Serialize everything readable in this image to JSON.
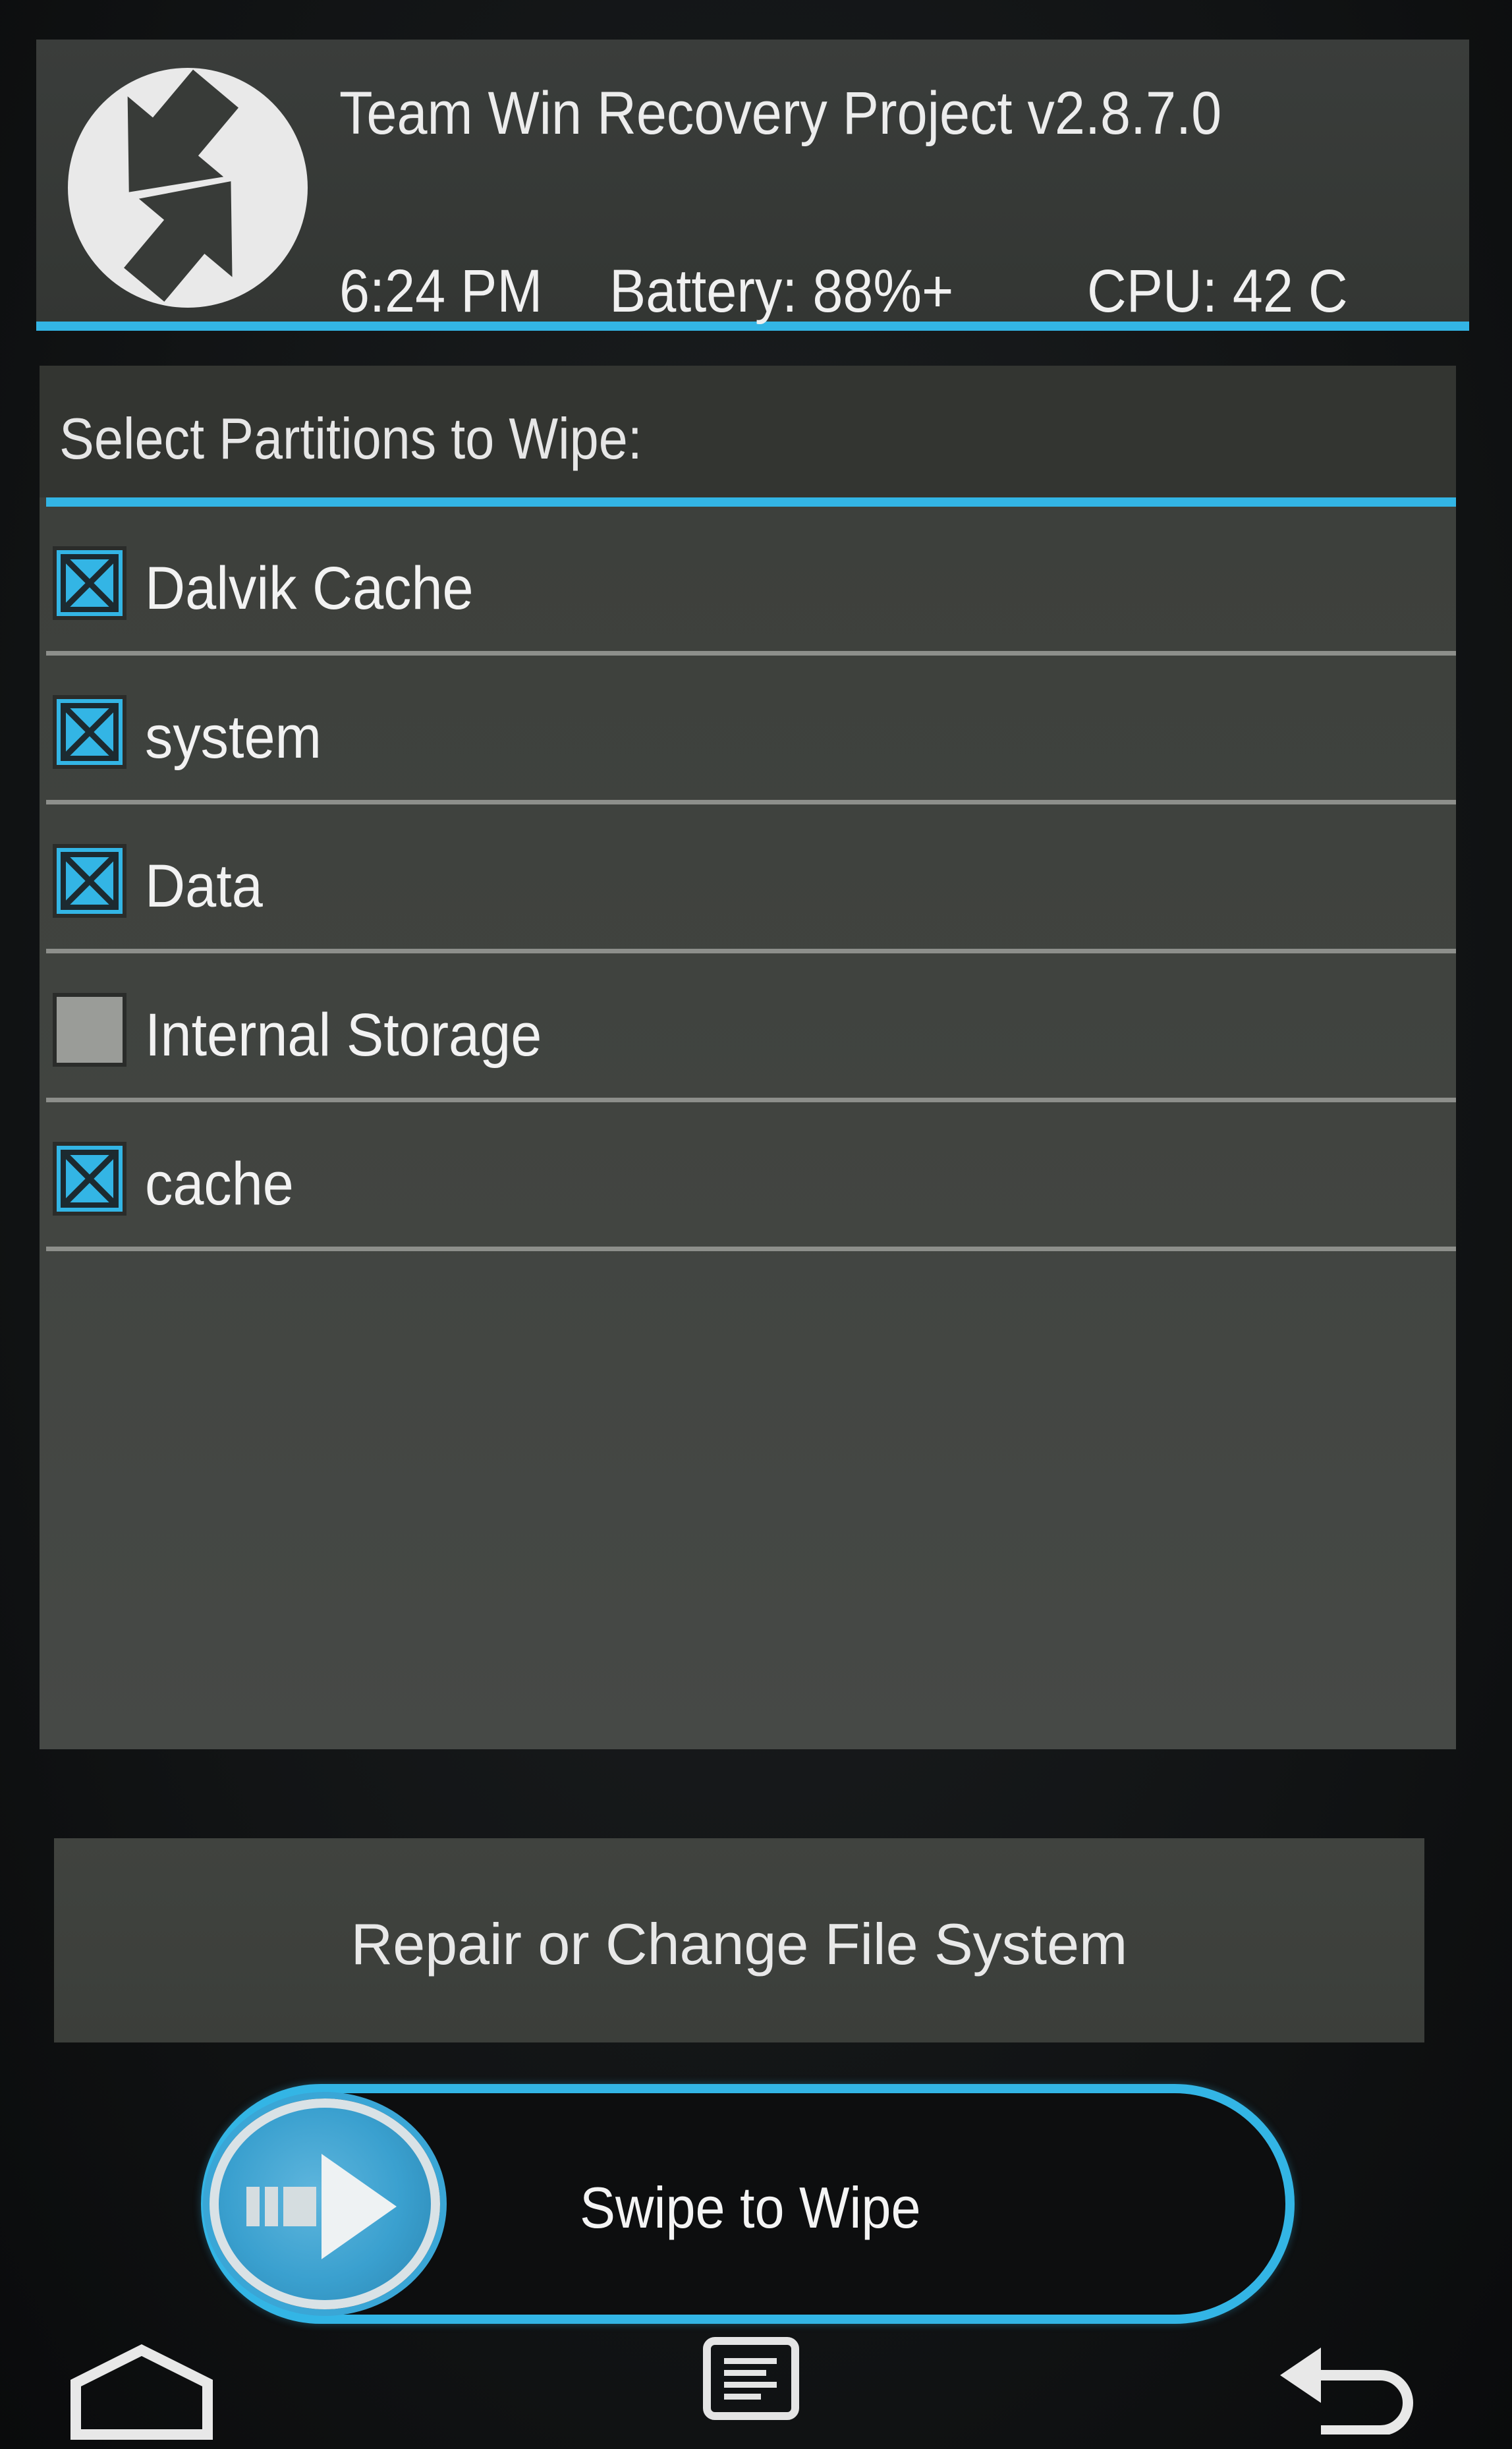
{
  "header": {
    "title": "Team Win Recovery Project  v2.8.7.0",
    "time": "6:24 PM",
    "battery": "Battery: 88%+",
    "cpu": "CPU: 42 C",
    "logo_icon": "twrp-logo-icon"
  },
  "wipe": {
    "heading": "Select Partitions to Wipe:",
    "partitions": [
      {
        "label": "Dalvik Cache",
        "checked": true
      },
      {
        "label": "system",
        "checked": true
      },
      {
        "label": "Data",
        "checked": true
      },
      {
        "label": "Internal Storage",
        "checked": false
      },
      {
        "label": "cache",
        "checked": true
      }
    ]
  },
  "repair_button": {
    "label": "Repair or Change File System"
  },
  "swipe": {
    "label": "Swipe to Wipe",
    "handle_icon": "arrow-right-icon"
  },
  "nav": {
    "home_icon": "home-icon",
    "console_icon": "console-icon",
    "back_icon": "back-icon"
  },
  "colors": {
    "accent": "#33b5e5",
    "panel": "#40433f",
    "header": "#383b38",
    "text": "#f0f0f0"
  }
}
